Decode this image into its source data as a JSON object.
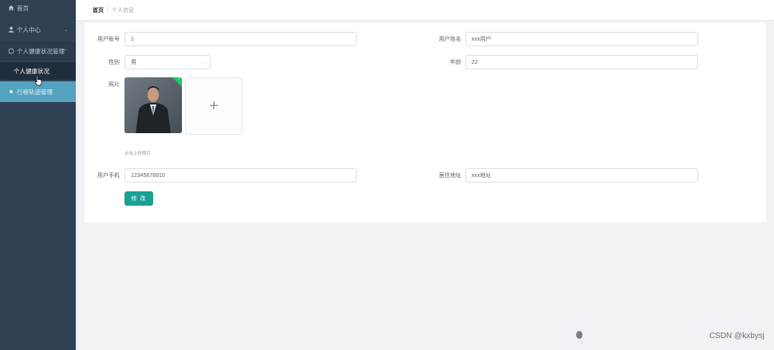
{
  "sidebar": {
    "items": [
      {
        "label": "首页",
        "icon": "home-icon"
      },
      {
        "label": "个人中心",
        "icon": "user-icon"
      },
      {
        "label": "个人健康状况管理",
        "icon": "chat-icon"
      },
      {
        "label": "个人健康状况",
        "icon": ""
      },
      {
        "label": "行程轨迹管理",
        "icon": "dot-icon"
      }
    ]
  },
  "breadcrumb": {
    "home": "首页",
    "separator": "/",
    "current": "个人信息"
  },
  "form": {
    "account_label": "用户账号",
    "account_value": "1",
    "name_label": "用户姓名",
    "name_value": "xxx用户",
    "gender_label": "性别",
    "gender_value": "男",
    "age_label": "年龄",
    "age_value": "22",
    "photo_label": "照片",
    "upload_tip": "点击上传照片",
    "phone_label": "用户手机",
    "phone_value": "12345678910",
    "address_label": "居住地址",
    "address_value": "xxx地址",
    "submit_label": "修 改"
  },
  "watermark": "CSDN @kxbysj",
  "colors": {
    "sidebar_bg": "#304156",
    "active_item_bg": "#53a2bf",
    "submit_bg": "#1aa094",
    "success_badge": "#13ce66"
  }
}
